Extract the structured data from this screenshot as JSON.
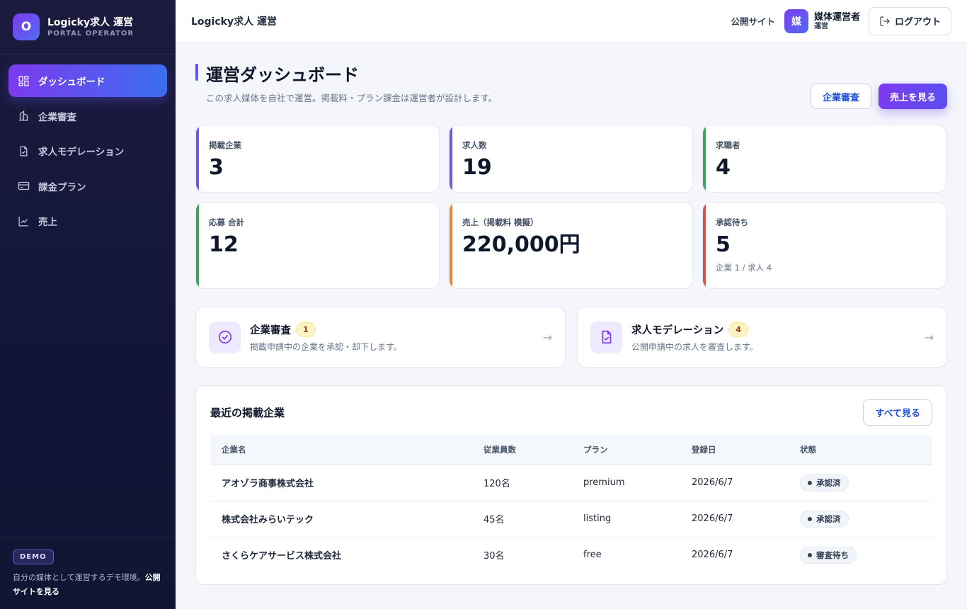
{
  "brand": {
    "logo_letter": "O",
    "name": "Logicky求人 運営",
    "sub": "PORTAL OPERATOR"
  },
  "nav": [
    {
      "label": "ダッシュボード",
      "icon": "dashboard-icon",
      "active": true
    },
    {
      "label": "企業審査",
      "icon": "building-icon",
      "active": false
    },
    {
      "label": "求人モデレーション",
      "icon": "clipboard-check-icon",
      "active": false
    },
    {
      "label": "課金プラン",
      "icon": "credit-card-icon",
      "active": false
    },
    {
      "label": "売上",
      "icon": "chart-line-icon",
      "active": false
    }
  ],
  "sidebar_footer": {
    "badge": "DEMO",
    "text": "自分の媒体として運営するデモ環境。",
    "link": "公開サイトを見る"
  },
  "topbar": {
    "title": "Logicky求人 運営",
    "public_link": "公開サイト",
    "user_avatar": "媒",
    "user_name": "媒体運営者",
    "user_role": "運営",
    "logout": "ログアウト"
  },
  "page": {
    "title": "運営ダッシュボード",
    "subtitle": "この求人媒体を自社で運営。掲載料・プラン課金は運営者が設計します。",
    "btn_review": "企業審査",
    "btn_sales": "売上を見る"
  },
  "stats": [
    {
      "label": "掲載企業",
      "value": "3",
      "sub": "",
      "accent": "#6d5ae6"
    },
    {
      "label": "求人数",
      "value": "19",
      "sub": "",
      "accent": "#6d5ae6"
    },
    {
      "label": "求職者",
      "value": "4",
      "sub": "",
      "accent": "#3aa35c"
    },
    {
      "label": "応募 合計",
      "value": "12",
      "sub": "",
      "accent": "#3aa35c"
    },
    {
      "label": "売上（掲載料 模擬）",
      "value": "220,000円",
      "sub": "",
      "accent": "#e8873a"
    },
    {
      "label": "承認待ち",
      "value": "5",
      "sub": "企業 1 / 求人 4",
      "accent": "#d9534f"
    }
  ],
  "actions": [
    {
      "title": "企業審査",
      "badge": "1",
      "desc": "掲載申請中の企業を承認・却下します。",
      "icon": "check-circle-icon"
    },
    {
      "title": "求人モデレーション",
      "badge": "4",
      "desc": "公開申請中の求人を審査します。",
      "icon": "document-check-icon"
    }
  ],
  "companies": {
    "title": "最近の掲載企業",
    "view_all": "すべて見る",
    "columns": [
      "企業名",
      "従業員数",
      "プラン",
      "登録日",
      "状態"
    ],
    "rows": [
      [
        "アオゾラ商事株式会社",
        "120名",
        "premium",
        "2026/6/7",
        "承認済"
      ],
      [
        "株式会社みらいテック",
        "45名",
        "listing",
        "2026/6/7",
        "承認済"
      ],
      [
        "さくらケアサービス株式会社",
        "30名",
        "free",
        "2026/6/7",
        "審査待ち"
      ]
    ]
  }
}
